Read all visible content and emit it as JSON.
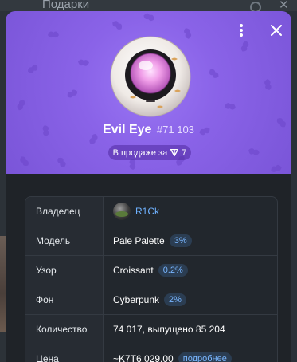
{
  "background": {
    "title": "Подарки"
  },
  "gift": {
    "name": "Evil Eye",
    "number": "#71 103",
    "sale_label": "В продаже за",
    "price": "7",
    "hero_color": "#8a63e8"
  },
  "details": [
    {
      "key": "Владелец",
      "value": "R1Ck",
      "type": "owner"
    },
    {
      "key": "Модель",
      "value": "Pale Palette",
      "badge": "3%"
    },
    {
      "key": "Узор",
      "value": "Croissant",
      "badge": "0.2%"
    },
    {
      "key": "Фон",
      "value": "Cyberpunk",
      "badge": "2%"
    },
    {
      "key": "Количество",
      "value": "74 017, выпущено 85 204"
    },
    {
      "key": "Цена",
      "value": "~K7T6 029.00",
      "badge": "подробнее"
    }
  ],
  "icons": {
    "menu": "kebab-menu-icon",
    "close": "close-icon",
    "ton": "ton-diamond-icon",
    "pattern": "croissant-pattern-icon"
  },
  "colors": {
    "accent": "#6fb2ff",
    "badge_bg": "#2b3d52",
    "panel_bg": "#1f2328"
  }
}
